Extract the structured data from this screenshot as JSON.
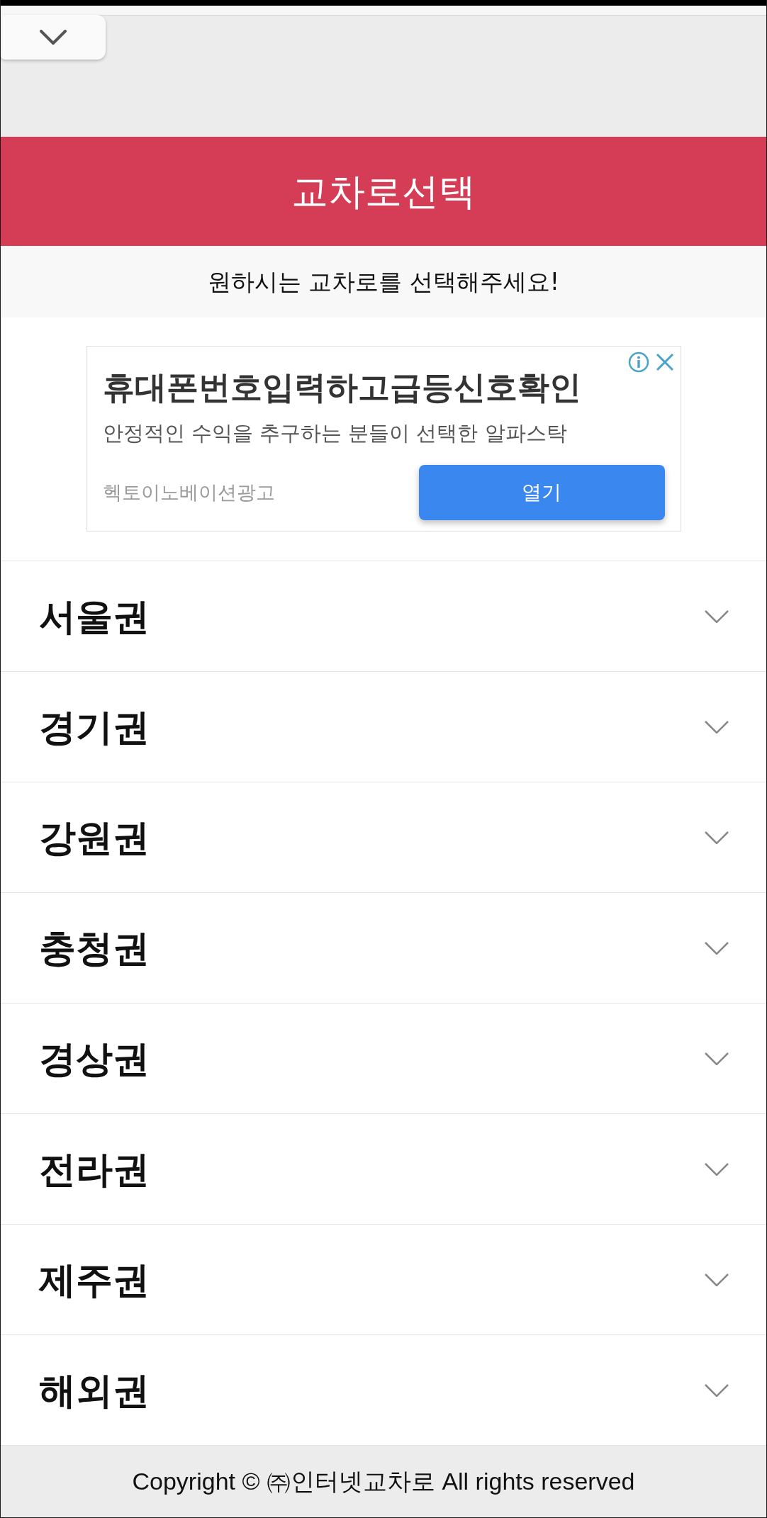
{
  "header": {
    "title": "교차로선택"
  },
  "subtitle": "원하시는 교차로를 선택해주세요!",
  "ad": {
    "title": "휴대폰번호입력하고급등신호확인",
    "description": "안정적인 수익을 추구하는 분들이 선택한 알파스탁",
    "sponsor": "헥토이노베이션광고",
    "button": "열기"
  },
  "regions": [
    {
      "label": "서울권",
      "expanded": false
    },
    {
      "label": "경기권",
      "expanded": false
    },
    {
      "label": "강원권",
      "expanded": false
    },
    {
      "label": "충청권",
      "expanded": false
    },
    {
      "label": "경상권",
      "expanded": false
    },
    {
      "label": "전라권",
      "expanded": false
    },
    {
      "label": "제주권",
      "expanded": false
    },
    {
      "label": "해외권",
      "expanded": false
    }
  ],
  "footer": "Copyright © ㈜인터넷교차로 All rights reserved"
}
